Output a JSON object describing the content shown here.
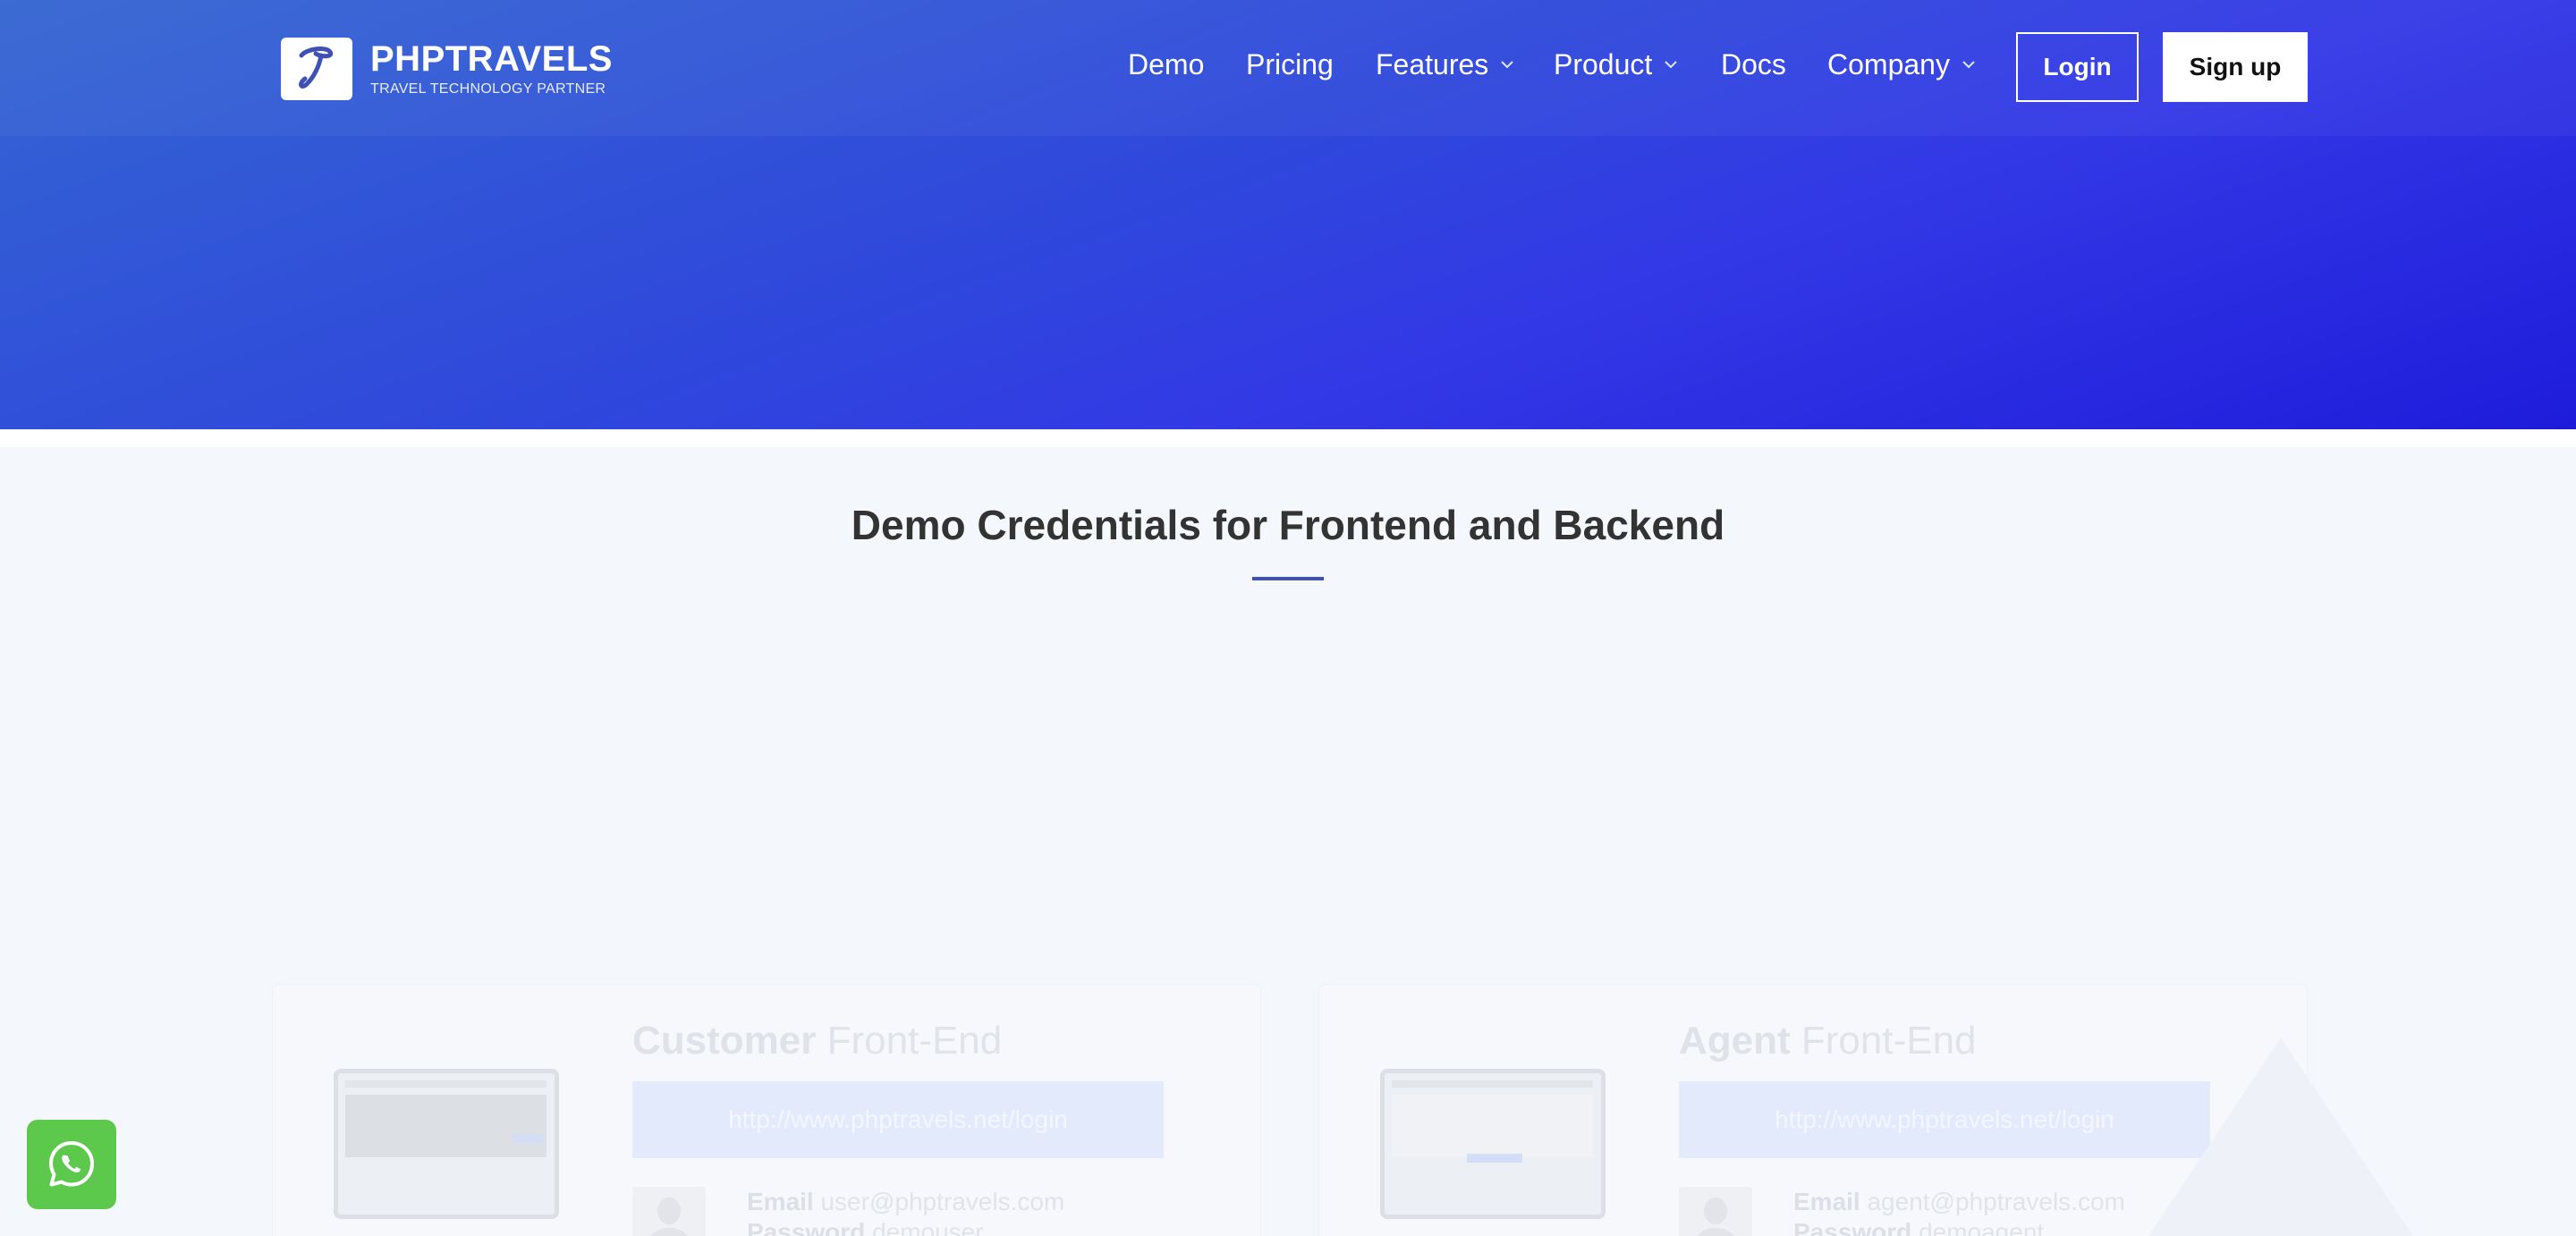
{
  "brand": {
    "name": "PHPTRAVELS",
    "tagline": "TRAVEL TECHNOLOGY PARTNER",
    "icon": "phptravels-logo-icon"
  },
  "nav": {
    "items": [
      {
        "label": "Demo",
        "dropdown": false
      },
      {
        "label": "Pricing",
        "dropdown": false
      },
      {
        "label": "Features",
        "dropdown": true
      },
      {
        "label": "Product",
        "dropdown": true
      },
      {
        "label": "Docs",
        "dropdown": false
      },
      {
        "label": "Company",
        "dropdown": true
      }
    ],
    "login_label": "Login",
    "signup_label": "Sign up"
  },
  "section": {
    "title": "Demo Credentials for Frontend and Backend"
  },
  "cards": [
    {
      "role": "Customer",
      "end": "Front-End",
      "url": "http://www.phptravels.net/login",
      "email_label": "Email",
      "email": "user@phptravels.com",
      "password_label": "Password",
      "password": "demouser"
    },
    {
      "role": "Agent",
      "end": "Front-End",
      "url": "http://www.phptravels.net/login",
      "email_label": "Email",
      "email": "agent@phptravels.com",
      "password_label": "Password",
      "password": "demoagent"
    }
  ],
  "widgets": {
    "whatsapp_icon": "whatsapp-icon"
  },
  "colors": {
    "hero_start": "#3465d2",
    "hero_end": "#1e1cda",
    "accent_underline": "#3f51b5",
    "whatsapp_green": "#5cc84c",
    "page_bg": "#f4f7fc"
  }
}
